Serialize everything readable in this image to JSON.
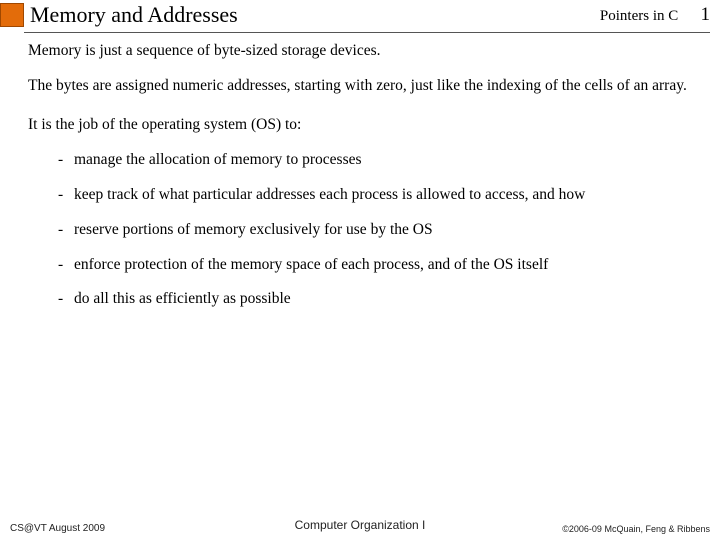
{
  "header": {
    "title": "Memory and Addresses",
    "course": "Pointers in C",
    "page": "1"
  },
  "content": {
    "p1": "Memory is just a sequence of byte-sized storage devices.",
    "p2": "The bytes are assigned numeric addresses, starting with zero, just like the indexing of the cells of an array.",
    "intro": "It is the job of the operating system (OS) to:",
    "bullets": [
      "manage the allocation of memory to processes",
      "keep track of what particular addresses each process is allowed to access, and how",
      "reserve portions of memory exclusively for use by the OS",
      "enforce protection of the memory space of each process, and of the OS itself",
      "do all this as efficiently as possible"
    ]
  },
  "footer": {
    "left": "CS@VT August 2009",
    "center": "Computer Organization I",
    "right": "©2006-09  McQuain, Feng & Ribbens"
  }
}
